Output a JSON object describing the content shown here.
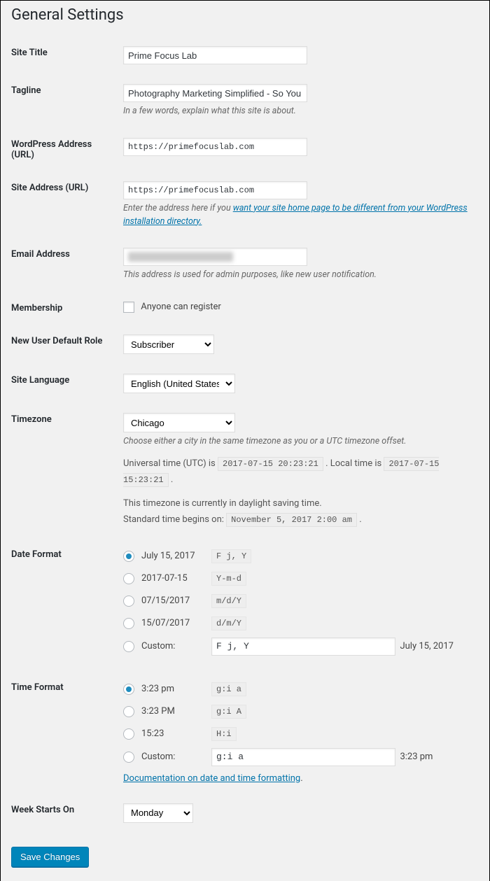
{
  "page_title": "General Settings",
  "site_title": {
    "label": "Site Title",
    "value": "Prime Focus Lab"
  },
  "tagline": {
    "label": "Tagline",
    "value": "Photography Marketing Simplified - So You Can Focus",
    "desc": "In a few words, explain what this site is about."
  },
  "wp_url": {
    "label": "WordPress Address (URL)",
    "value": "https://primefocuslab.com"
  },
  "site_url": {
    "label": "Site Address (URL)",
    "value": "https://primefocuslab.com",
    "desc_prefix": "Enter the address here if you ",
    "desc_link": "want your site home page to be different from your WordPress installation directory."
  },
  "email": {
    "label": "Email Address",
    "desc": "This address is used for admin purposes, like new user notification."
  },
  "membership": {
    "label": "Membership",
    "checkbox_label": "Anyone can register"
  },
  "default_role": {
    "label": "New User Default Role",
    "value": "Subscriber"
  },
  "site_lang": {
    "label": "Site Language",
    "value": "English (United States)"
  },
  "timezone": {
    "label": "Timezone",
    "value": "Chicago",
    "desc": "Choose either a city in the same timezone as you or a UTC timezone offset.",
    "utc_label": "Universal time (UTC) is",
    "utc_time": "2017-07-15 20:23:21",
    "local_label": ". Local time is",
    "local_time": "2017-07-15 15:23:21",
    "dst_text": "This timezone is currently in daylight saving time.",
    "std_text": "Standard time begins on:",
    "std_time": "November 5, 2017 2:00 am"
  },
  "date_format": {
    "label": "Date Format",
    "options": [
      {
        "label": "July 15, 2017",
        "code": "F j, Y",
        "checked": true
      },
      {
        "label": "2017-07-15",
        "code": "Y-m-d",
        "checked": false
      },
      {
        "label": "07/15/2017",
        "code": "m/d/Y",
        "checked": false
      },
      {
        "label": "15/07/2017",
        "code": "d/m/Y",
        "checked": false
      }
    ],
    "custom_label": "Custom:",
    "custom_value": "F j, Y",
    "custom_preview": "July 15, 2017"
  },
  "time_format": {
    "label": "Time Format",
    "options": [
      {
        "label": "3:23 pm",
        "code": "g:i a",
        "checked": true
      },
      {
        "label": "3:23 PM",
        "code": "g:i A",
        "checked": false
      },
      {
        "label": "15:23",
        "code": "H:i",
        "checked": false
      }
    ],
    "custom_label": "Custom:",
    "custom_value": "g:i a",
    "custom_preview": "3:23 pm",
    "doc_link": "Documentation on date and time formatting"
  },
  "week_starts": {
    "label": "Week Starts On",
    "value": "Monday"
  },
  "save_button": "Save Changes"
}
